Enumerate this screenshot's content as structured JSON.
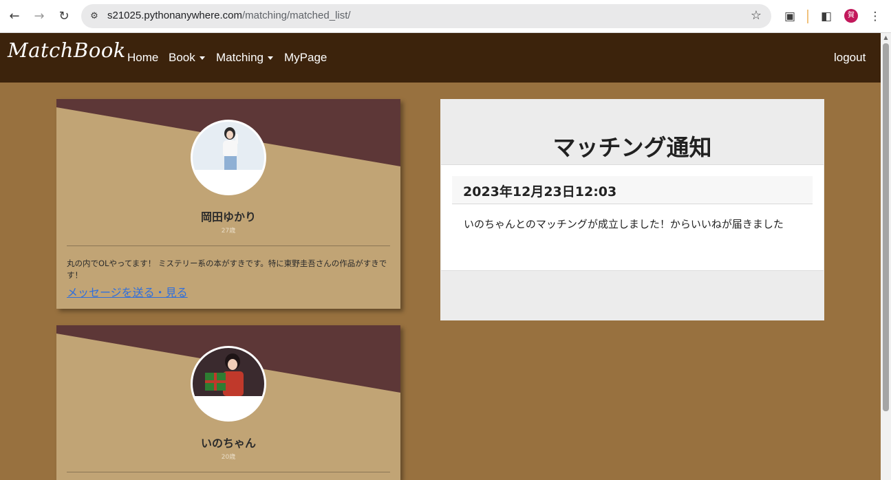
{
  "browser": {
    "url_host": "s21025.pythonanywhere.com",
    "url_path": "/matching/matched_list/",
    "back_icon": "arrow-left-icon",
    "forward_icon": "arrow-right-icon",
    "reload_icon": "reload-icon",
    "profile_initial": "賀"
  },
  "navbar": {
    "brand": "MatchBook",
    "links": [
      {
        "label": "Home"
      },
      {
        "label": "Book"
      },
      {
        "label": "Matching"
      },
      {
        "label": "MyPage"
      }
    ],
    "logout": "logout"
  },
  "profiles": [
    {
      "name": "岡田ゆかり",
      "age": "27歳",
      "bio": "丸の内でOLやってます！ ミステリー系の本がすきです。特に東野圭吾さんの作品がすきです！",
      "link": "メッセージを送る・見る"
    },
    {
      "name": "いのちゃん",
      "age": "20歳"
    }
  ],
  "notifications": {
    "title": "マッチング通知",
    "items": [
      {
        "date": "2023年12月23日12:03",
        "message": "いのちゃんとのマッチングが成立しました！からいいねが届きました"
      }
    ]
  },
  "colors": {
    "page_bg": "#98713f",
    "navbar_bg": "#3c230c",
    "card_bg": "#c1a475",
    "card_band": "#5d3737",
    "link": "#2f6fdd"
  }
}
